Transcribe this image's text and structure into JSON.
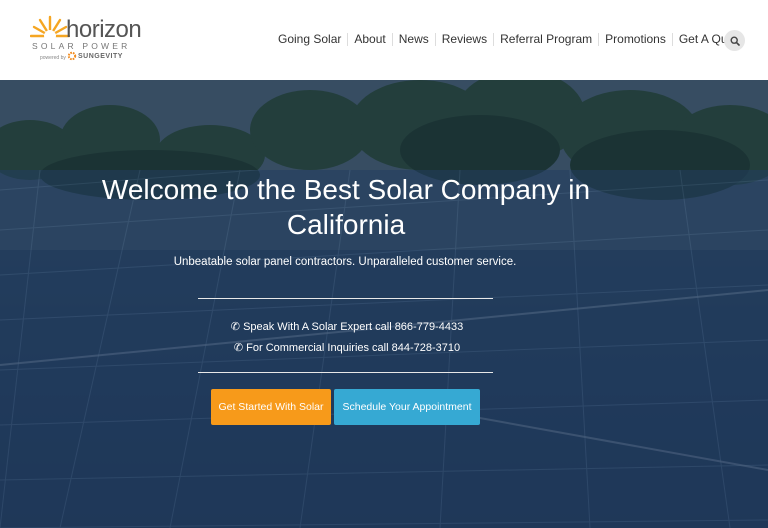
{
  "logo": {
    "wordmark": "horizon",
    "tagline": "SOLAR POWER",
    "powered_by": "powered by",
    "partner": "SUNGEVITY"
  },
  "nav": {
    "items": [
      "Going Solar",
      "About",
      "News",
      "Reviews",
      "Referral Program",
      "Promotions",
      "Get A Quote"
    ],
    "search_icon": "search-icon"
  },
  "hero": {
    "title": "Welcome to the Best Solar Company in California",
    "subtitle": "Unbeatable solar panel contractors. Unparalleled customer service.",
    "phone_expert": "Speak With A Solar Expert call 866-779-4433",
    "phone_commercial": "For Commercial Inquiries call 844-728-3710",
    "cta_primary": "Get Started With Solar",
    "cta_secondary": "Schedule Your Appointment"
  },
  "colors": {
    "orange": "#f79a1a",
    "blue": "#36a9d3",
    "hero_bg": "#263f5e"
  }
}
